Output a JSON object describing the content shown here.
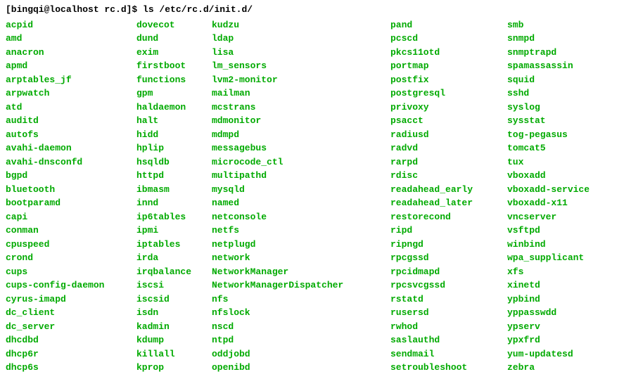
{
  "prompt": "[bingqi@localhost rc.d]$ ls /etc/rc.d/init.d/",
  "col1": [
    "acpid",
    "amd",
    "anacron",
    "apmd",
    "arptables_jf",
    "arpwatch",
    "atd",
    "auditd",
    "autofs",
    "avahi-daemon",
    "avahi-dnsconfd",
    "bgpd",
    "bluetooth",
    "bootparamd",
    "capi",
    "conman",
    "cpuspeed",
    "crond",
    "cups",
    "cups-config-daemon",
    "cyrus-imapd",
    "dc_client",
    "dc_server",
    "dhcdbd",
    "dhcp6r",
    "dhcp6s"
  ],
  "col2": [
    "dovecot",
    "dund",
    "exim",
    "firstboot",
    "functions",
    "gpm",
    "haldaemon",
    "halt",
    "hidd",
    "hplip",
    "hsqldb",
    "httpd",
    "ibmasm",
    "innd",
    "ip6tables",
    "ipmi",
    "iptables",
    "irda",
    "irqbalance",
    "iscsi",
    "iscsid",
    "isdn",
    "kadmin",
    "kdump",
    "killall",
    "kprop"
  ],
  "col3": [
    "kudzu",
    "ldap",
    "lisa",
    "lm_sensors",
    "lvm2-monitor",
    "mailman",
    "mcstrans",
    "mdmonitor",
    "mdmpd",
    "messagebus",
    "microcode_ctl",
    "multipathd",
    "mysqld",
    "named",
    "netconsole",
    "netfs",
    "netplugd",
    "network",
    "NetworkManager",
    "NetworkManagerDispatcher",
    "nfs",
    "nfslock",
    "nscd",
    "ntpd",
    "oddjobd",
    "openibd"
  ],
  "col4": [
    "pand",
    "pcscd",
    "pkcs11otd",
    "portmap",
    "postfix",
    "postgresql",
    "privoxy",
    "psacct",
    "radiusd",
    "radvd",
    "rarpd",
    "rdisc",
    "readahead_early",
    "readahead_later",
    "restorecond",
    "ripd",
    "ripngd",
    "rpcgssd",
    "rpcidmapd",
    "rpcsvcgssd",
    "rstatd",
    "rusersd",
    "rwhod",
    "saslauthd",
    "sendmail",
    "setroubleshoot"
  ],
  "col5": [
    "smb",
    "snmpd",
    "snmptrapd",
    "spamassassin",
    "squid",
    "sshd",
    "syslog",
    "sysstat",
    "tog-pegasus",
    "tomcat5",
    "tux",
    "vboxadd",
    "vboxadd-service",
    "vboxadd-x11",
    "vncserver",
    "vsftpd",
    "winbind",
    "wpa_supplicant",
    "xfs",
    "xinetd",
    "ypbind",
    "yppasswdd",
    "ypserv",
    "ypxfrd",
    "yum-updatesd",
    "zebra"
  ]
}
